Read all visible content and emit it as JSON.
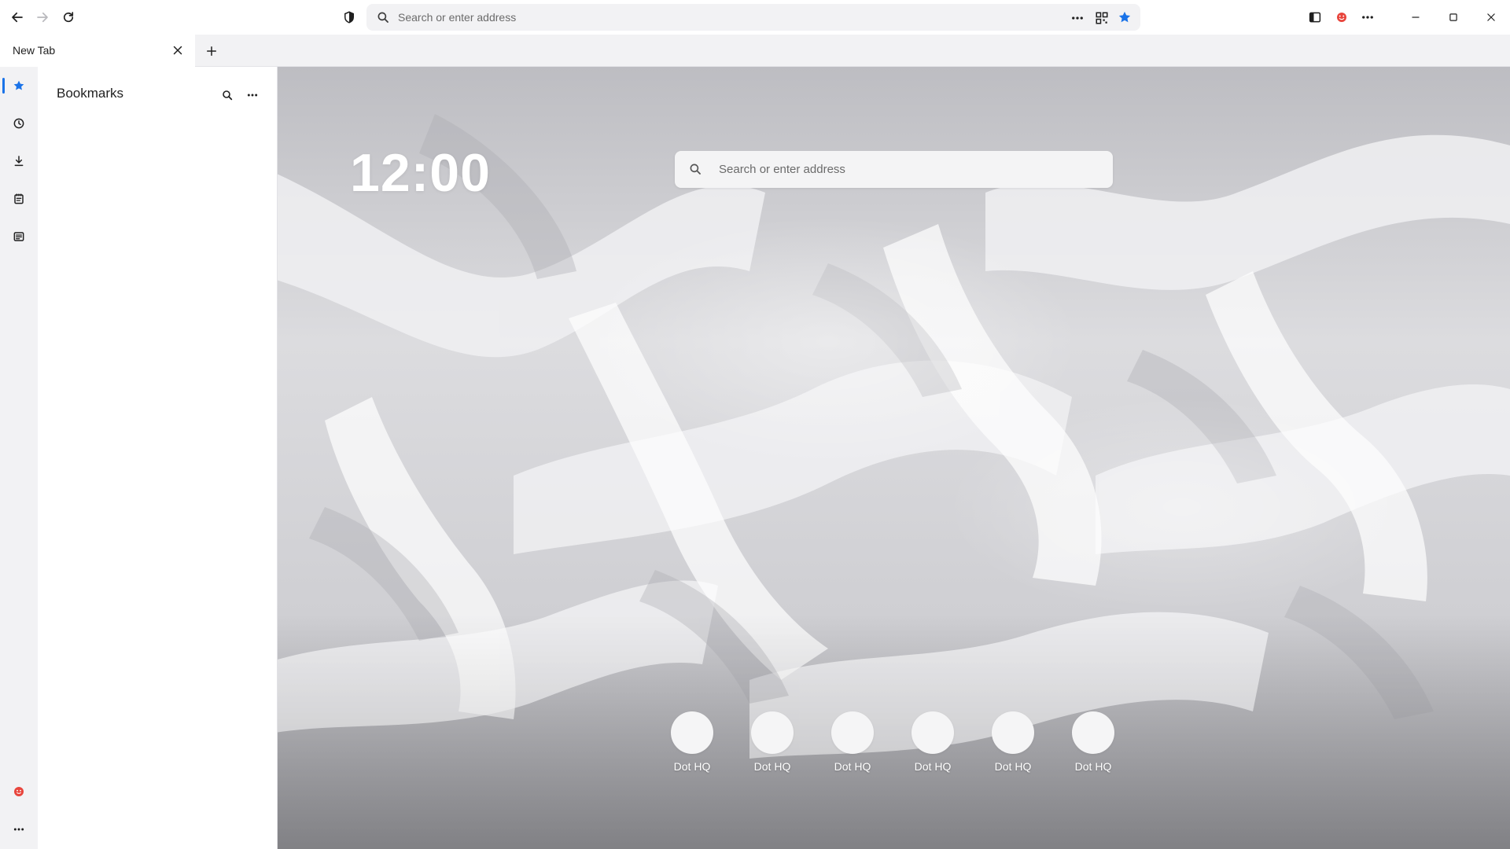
{
  "toolbar": {
    "address_placeholder": "Search or enter address",
    "accent_color": "#1a73e8",
    "profile_color": "#e8453c"
  },
  "tabs": [
    {
      "label": "New Tab",
      "active": true
    }
  ],
  "rail": {
    "items": [
      {
        "name": "bookmarks",
        "icon": "star-icon",
        "active": true
      },
      {
        "name": "history",
        "icon": "clock-icon"
      },
      {
        "name": "downloads",
        "icon": "download-icon"
      },
      {
        "name": "notes",
        "icon": "notepad-icon"
      },
      {
        "name": "reader",
        "icon": "reader-icon"
      }
    ],
    "bottom": [
      {
        "name": "profile",
        "icon": "profile-icon"
      },
      {
        "name": "more",
        "icon": "more-icon"
      }
    ]
  },
  "bookmarks_panel": {
    "title": "Bookmarks"
  },
  "new_tab_page": {
    "clock": "12:00",
    "search_placeholder": "Search or enter address",
    "shortcuts": [
      {
        "label": "Dot HQ"
      },
      {
        "label": "Dot HQ"
      },
      {
        "label": "Dot HQ"
      },
      {
        "label": "Dot HQ"
      },
      {
        "label": "Dot HQ"
      },
      {
        "label": "Dot HQ"
      }
    ]
  }
}
